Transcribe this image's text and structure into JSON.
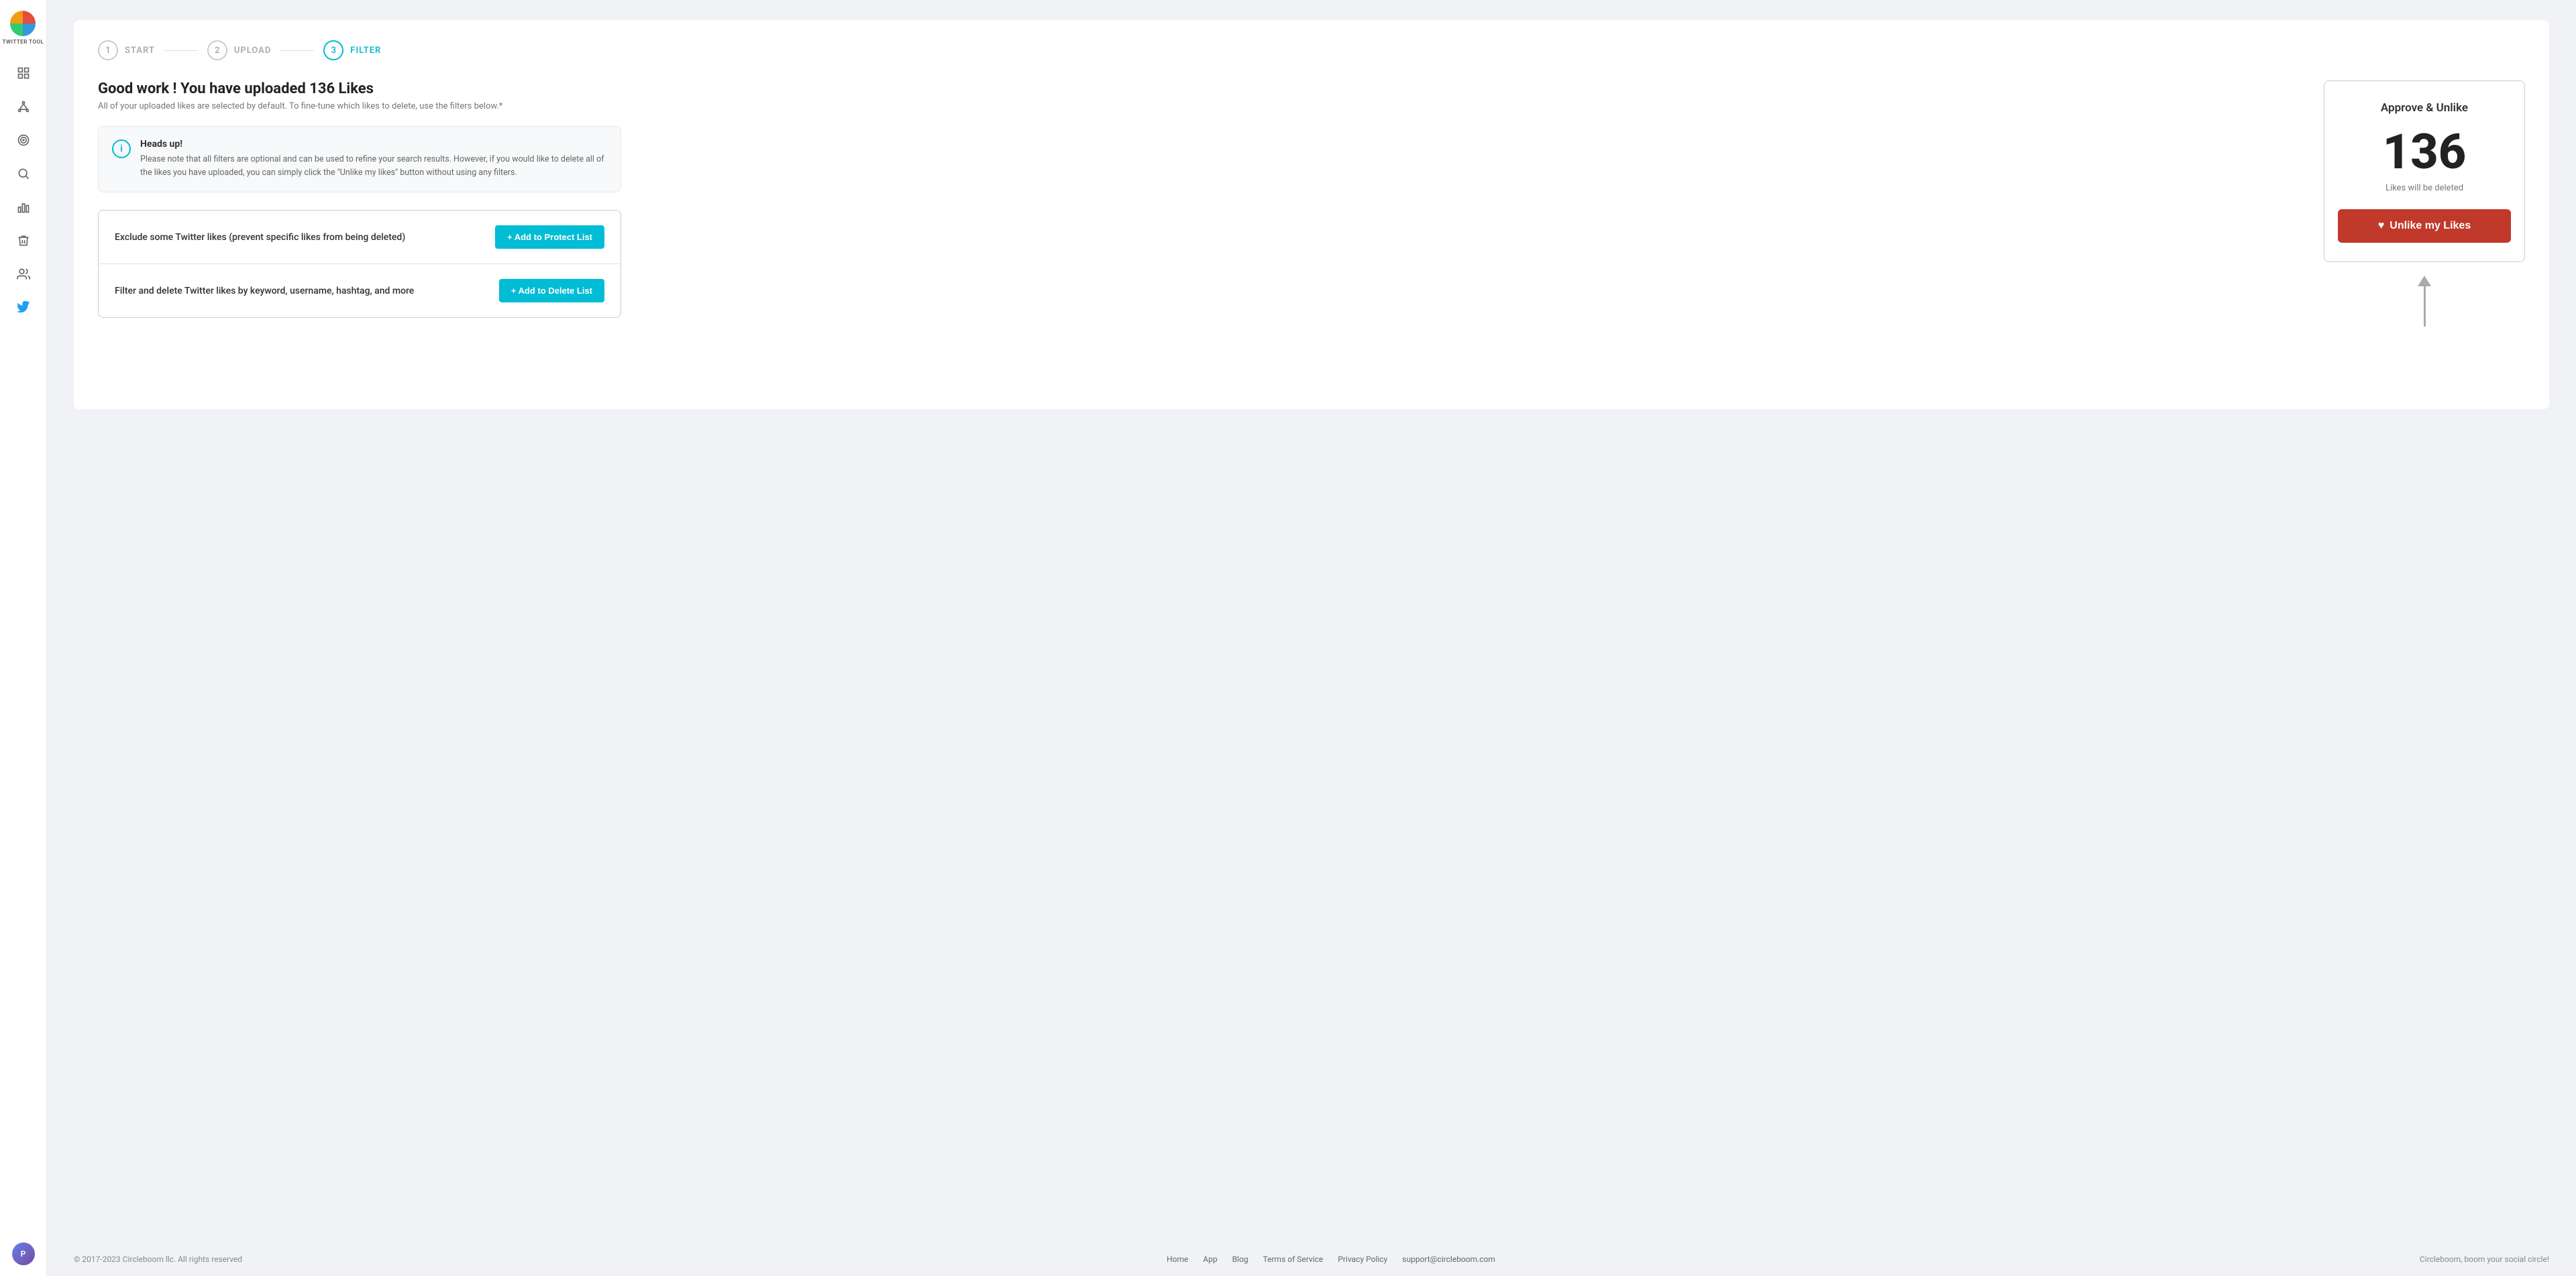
{
  "sidebar": {
    "logo_text": "TWITTER TOOL",
    "items": [
      {
        "name": "dashboard",
        "label": "Dashboard"
      },
      {
        "name": "network",
        "label": "Network"
      },
      {
        "name": "target",
        "label": "Target"
      },
      {
        "name": "search",
        "label": "Search"
      },
      {
        "name": "analytics",
        "label": "Analytics"
      },
      {
        "name": "delete",
        "label": "Delete"
      },
      {
        "name": "friends",
        "label": "Friends"
      },
      {
        "name": "twitter",
        "label": "Twitter"
      }
    ]
  },
  "stepper": {
    "steps": [
      {
        "number": "1",
        "label": "START",
        "active": false
      },
      {
        "number": "2",
        "label": "UPLOAD",
        "active": false
      },
      {
        "number": "3",
        "label": "FILTER",
        "active": true
      }
    ]
  },
  "main": {
    "heading": "Good work ! You have uploaded 136 Likes",
    "subheading": "All of your uploaded likes are selected by default. To fine-tune which likes to delete, use the filters below.*",
    "info": {
      "title": "Heads up!",
      "text": "Please note that all filters are optional and can be used to refine your search results. However, if you would like to delete all of the likes you have uploaded, you can simply click the \"Unlike my likes\" button without using any filters."
    },
    "filters": [
      {
        "label": "Exclude some Twitter likes (prevent specific likes from being deleted)",
        "button": "+ Add to Protect List"
      },
      {
        "label": "Filter and delete Twitter likes by keyword, username, hashtag, and more",
        "button": "+ Add to Delete List"
      }
    ]
  },
  "approve_panel": {
    "title": "Approve & Unlike",
    "count": "136",
    "subtitle": "Likes will be deleted",
    "button_label": "Unlike my Likes"
  },
  "footer": {
    "copyright": "© 2017-2023 Circleboom llc. All rights reserved",
    "links": [
      {
        "label": "Home"
      },
      {
        "label": "App"
      },
      {
        "label": "Blog"
      },
      {
        "label": "Terms of Service"
      },
      {
        "label": "Privacy Policy"
      },
      {
        "label": "support@circleboom.com"
      }
    ],
    "tagline": "Circleboom, boom your social circle!"
  }
}
